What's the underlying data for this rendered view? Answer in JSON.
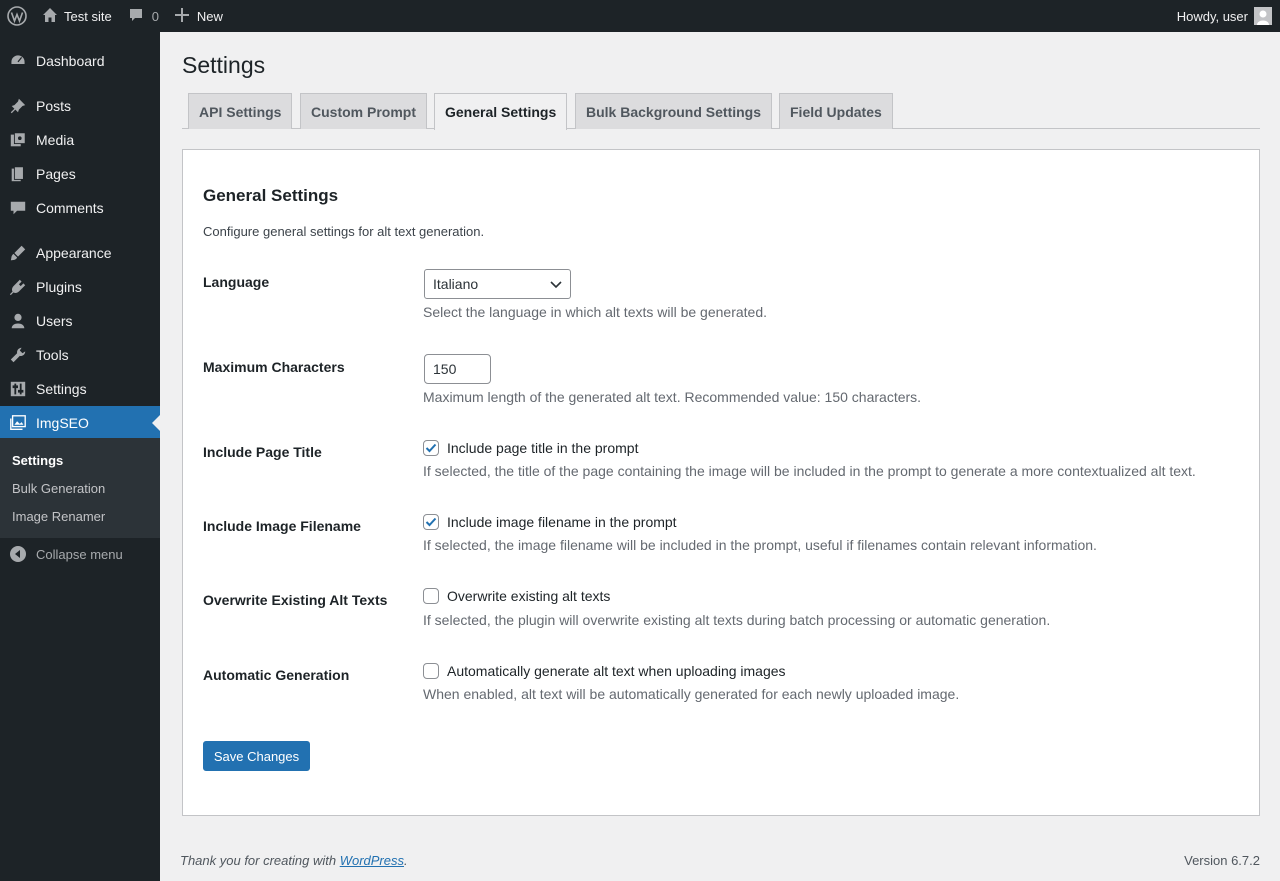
{
  "adminbar": {
    "site_name": "Test site",
    "comments_count": "0",
    "new_label": "New",
    "greeting": "Howdy, user"
  },
  "sidebar": {
    "items": [
      {
        "label": "Dashboard",
        "icon": "dashboard-icon"
      },
      {
        "label": "Posts",
        "icon": "pin-icon"
      },
      {
        "label": "Media",
        "icon": "media-icon"
      },
      {
        "label": "Pages",
        "icon": "pages-icon"
      },
      {
        "label": "Comments",
        "icon": "comment-icon"
      },
      {
        "label": "Appearance",
        "icon": "brush-icon"
      },
      {
        "label": "Plugins",
        "icon": "plugin-icon"
      },
      {
        "label": "Users",
        "icon": "user-icon"
      },
      {
        "label": "Tools",
        "icon": "wrench-icon"
      },
      {
        "label": "Settings",
        "icon": "sliders-icon"
      },
      {
        "label": "ImgSEO",
        "icon": "images-icon"
      }
    ],
    "submenu": [
      "Settings",
      "Bulk Generation",
      "Image Renamer"
    ],
    "collapse_label": "Collapse menu"
  },
  "page": {
    "title": "Settings",
    "tabs": [
      "API Settings",
      "Custom Prompt",
      "General Settings",
      "Bulk Background Settings",
      "Field Updates"
    ],
    "active_tab": "General Settings"
  },
  "general": {
    "heading": "General Settings",
    "intro": "Configure general settings for alt text generation.",
    "language": {
      "label": "Language",
      "value": "Italiano",
      "description": "Select the language in which alt texts will be generated."
    },
    "max_chars": {
      "label": "Maximum Characters",
      "value": "150",
      "description": "Maximum length of the generated alt text. Recommended value: 150 characters."
    },
    "include_title": {
      "label": "Include Page Title",
      "checkbox_label": "Include page title in the prompt",
      "checked": true,
      "description": "If selected, the title of the page containing the image will be included in the prompt to generate a more contextualized alt text."
    },
    "include_filename": {
      "label": "Include Image Filename",
      "checkbox_label": "Include image filename in the prompt",
      "checked": true,
      "description": "If selected, the image filename will be included in the prompt, useful if filenames contain relevant information."
    },
    "overwrite": {
      "label": "Overwrite Existing Alt Texts",
      "checkbox_label": "Overwrite existing alt texts",
      "checked": false,
      "description": "If selected, the plugin will overwrite existing alt texts during batch processing or automatic generation."
    },
    "auto_gen": {
      "label": "Automatic Generation",
      "checkbox_label": "Automatically generate alt text when uploading images",
      "checked": false,
      "description": "When enabled, alt text will be automatically generated for each newly uploaded image."
    },
    "save_label": "Save Changes"
  },
  "footer": {
    "thanks_prefix": "Thank you for creating with ",
    "thanks_link": "WordPress",
    "thanks_suffix": ".",
    "version": "Version 6.7.2"
  },
  "colors": {
    "accent": "#2271b1",
    "adminbar_bg": "#1d2327",
    "sidebar_bg": "#1d2327",
    "submenu_bg": "#2c3338",
    "page_bg": "#f0f0f1"
  }
}
